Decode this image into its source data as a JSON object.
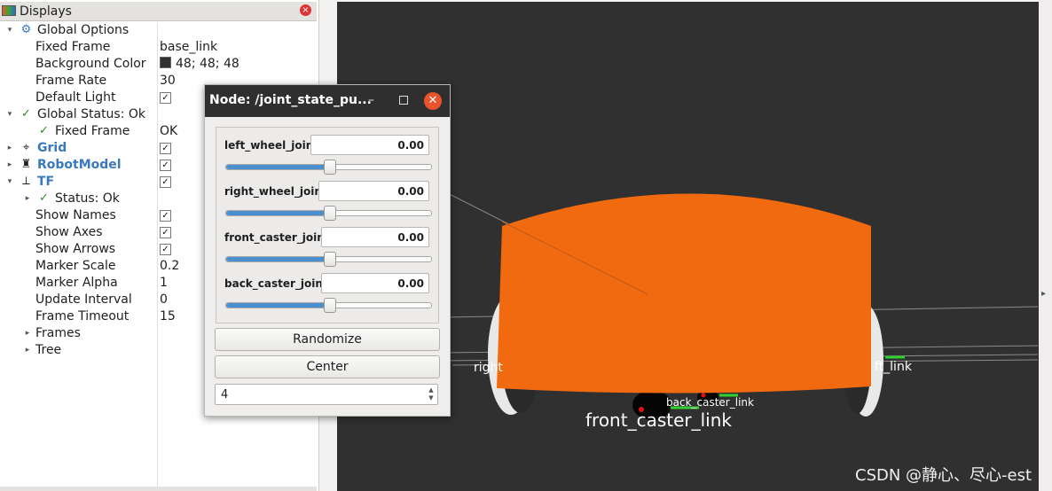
{
  "displays_panel": {
    "title": "Displays",
    "rows": [
      {
        "label": "Global Options",
        "arrow": "▾",
        "icon": "gear-icon"
      },
      {
        "label": "Fixed Frame",
        "value": "base_link"
      },
      {
        "label": "Background Color",
        "value": "48; 48; 48"
      },
      {
        "label": "Frame Rate",
        "value": "30"
      },
      {
        "label": "Default Light",
        "checked": true
      },
      {
        "label": "Global Status: Ok",
        "arrow": "▾"
      },
      {
        "label": "Fixed Frame",
        "value": "OK"
      },
      {
        "label": "Grid",
        "arrow": "▸",
        "checked": true
      },
      {
        "label": "RobotModel",
        "arrow": "▸",
        "checked": true
      },
      {
        "label": "TF",
        "arrow": "▾",
        "checked": true
      },
      {
        "label": "Status: Ok",
        "arrow": "▸"
      },
      {
        "label": "Show Names",
        "checked": true
      },
      {
        "label": "Show Axes",
        "checked": true
      },
      {
        "label": "Show Arrows",
        "checked": true
      },
      {
        "label": "Marker Scale",
        "value": "0.2"
      },
      {
        "label": "Marker Alpha",
        "value": "1"
      },
      {
        "label": "Update Interval",
        "value": "0"
      },
      {
        "label": "Frame Timeout",
        "value": "15"
      },
      {
        "label": "Frames",
        "arrow": "▸"
      },
      {
        "label": "Tree",
        "arrow": "▸"
      }
    ],
    "check_mark": "✓",
    "close_glyph": "×"
  },
  "dialog": {
    "title": "Node: /joint_state_pu...",
    "minimize_glyph": "–",
    "close_glyph": "✕",
    "joints": [
      {
        "name": "left_wheel_joint",
        "value": "0.00",
        "slider_fraction": 0.5
      },
      {
        "name": "right_wheel_joint",
        "value": "0.00",
        "slider_fraction": 0.5
      },
      {
        "name": "front_caster_joint",
        "value": "0.00",
        "slider_fraction": 0.5
      },
      {
        "name": "back_caster_joint",
        "value": "0.00",
        "slider_fraction": 0.5
      }
    ],
    "randomize_label": "Randomize",
    "center_label": "Center",
    "spin_value": "4"
  },
  "view": {
    "labels": {
      "right": "right",
      "left_link": "ft_link",
      "back_caster_link": "back_caster_link",
      "front_caster_link": "front_caster_link"
    },
    "watermark": "CSDN @静心、尽心-est",
    "colors": {
      "background": "#303030",
      "body": "#f26a10"
    }
  }
}
